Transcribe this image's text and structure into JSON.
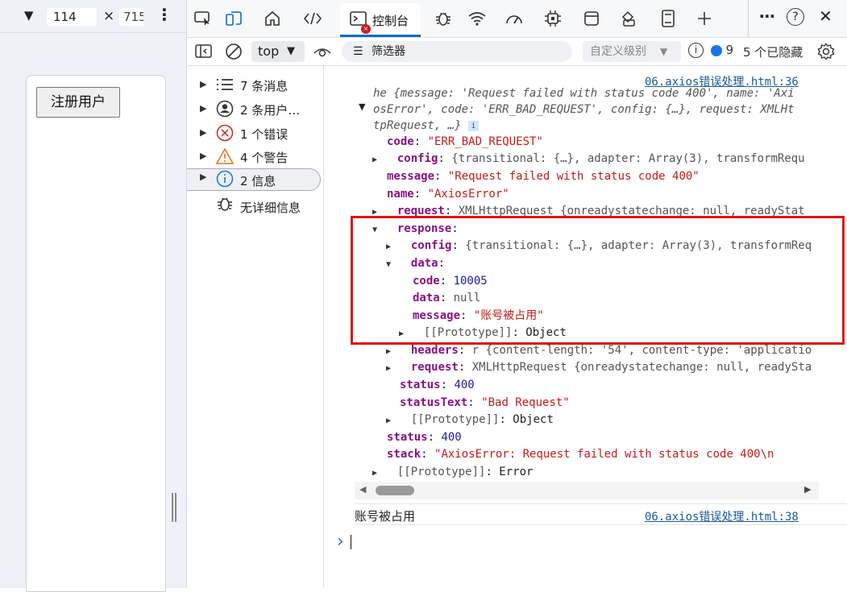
{
  "device_bar": {
    "width": "114",
    "height": "715",
    "close_symbol": "×",
    "more_symbol": "⋮"
  },
  "page": {
    "register_button": "注册用户"
  },
  "toolbar": {
    "tabs": [
      {
        "name": "inspect-icon"
      },
      {
        "name": "device-toolbar-icon"
      },
      {
        "name": "home-icon"
      },
      {
        "name": "elements-icon"
      },
      {
        "label": "控制台",
        "active": true
      },
      {
        "name": "bug-icon"
      },
      {
        "name": "network-icon"
      },
      {
        "name": "performance-icon"
      },
      {
        "name": "cpu-icon"
      },
      {
        "name": "application-icon"
      },
      {
        "name": "paint-icon"
      },
      {
        "name": "memory-icon"
      },
      {
        "name": "plus-icon"
      }
    ],
    "more": "⋯",
    "help": "?",
    "close": "✕"
  },
  "toolbar2": {
    "context": "top",
    "filter_placeholder": "筛选器",
    "level": "自定义级别",
    "issue_count": "9",
    "hidden_count": "5 个已隐藏"
  },
  "sidebar": {
    "items": [
      {
        "label": "7 条消息",
        "icon": "list-icon"
      },
      {
        "label": "2 条用户…",
        "icon": "user-icon"
      },
      {
        "label": "1 个错误",
        "icon": "error-icon"
      },
      {
        "label": "4 个警告",
        "icon": "warning-icon"
      },
      {
        "label": "2 信息",
        "icon": "info-icon",
        "selected": true
      },
      {
        "label": "无详细信息",
        "icon": "bug-icon"
      }
    ]
  },
  "console": {
    "source1": "06.axios错误处理.html:36",
    "header_line1": "he {message: 'Request failed with status code 400', name: 'Axi",
    "header_line2": "osError', code: 'ERR_BAD_REQUEST', config: {…}, request: XMLHt",
    "header_line3": "tpRequest, …}",
    "rows": {
      "code": {
        "key": "code",
        "val": "\"ERR_BAD_REQUEST\""
      },
      "config": {
        "key": "config",
        "val": "{transitional: {…}, adapter: Array(3), transformRequ"
      },
      "message": {
        "key": "message",
        "val": "\"Request failed with status code 400\""
      },
      "name": {
        "key": "name",
        "val": "\"AxiosError\""
      },
      "request": {
        "key": "request",
        "val": "XMLHttpRequest {onreadystatechange: null, readyStat"
      },
      "response": {
        "key": "response"
      },
      "r_config": {
        "key": "config",
        "val": "{transitional: {…}, adapter: Array(3), transformReq"
      },
      "r_data": {
        "key": "data"
      },
      "d_code": {
        "key": "code",
        "val": "10005"
      },
      "d_data": {
        "key": "data",
        "val": "null"
      },
      "d_message": {
        "key": "message",
        "val": "\"账号被占用\""
      },
      "d_proto": {
        "key": "[[Prototype]]",
        "val": "Object"
      },
      "r_headers": {
        "key": "headers",
        "val": "r {content-length: '54', content-type: 'applicatio"
      },
      "r_request": {
        "key": "request",
        "val": "XMLHttpRequest {onreadystatechange: null, readySta"
      },
      "r_status": {
        "key": "status",
        "val": "400"
      },
      "r_statusText": {
        "key": "statusText",
        "val": "\"Bad Request\""
      },
      "r_proto": {
        "key": "[[Prototype]]",
        "val": "Object"
      },
      "status": {
        "key": "status",
        "val": "400"
      },
      "stack": {
        "key": "stack",
        "val": "\"AxiosError: Request failed with status code 400\\n"
      },
      "proto": {
        "key": "[[Prototype]]",
        "val": "Error"
      }
    },
    "log_text": "账号被占用",
    "source2": "06.axios错误处理.html:38",
    "prompt": "›"
  }
}
